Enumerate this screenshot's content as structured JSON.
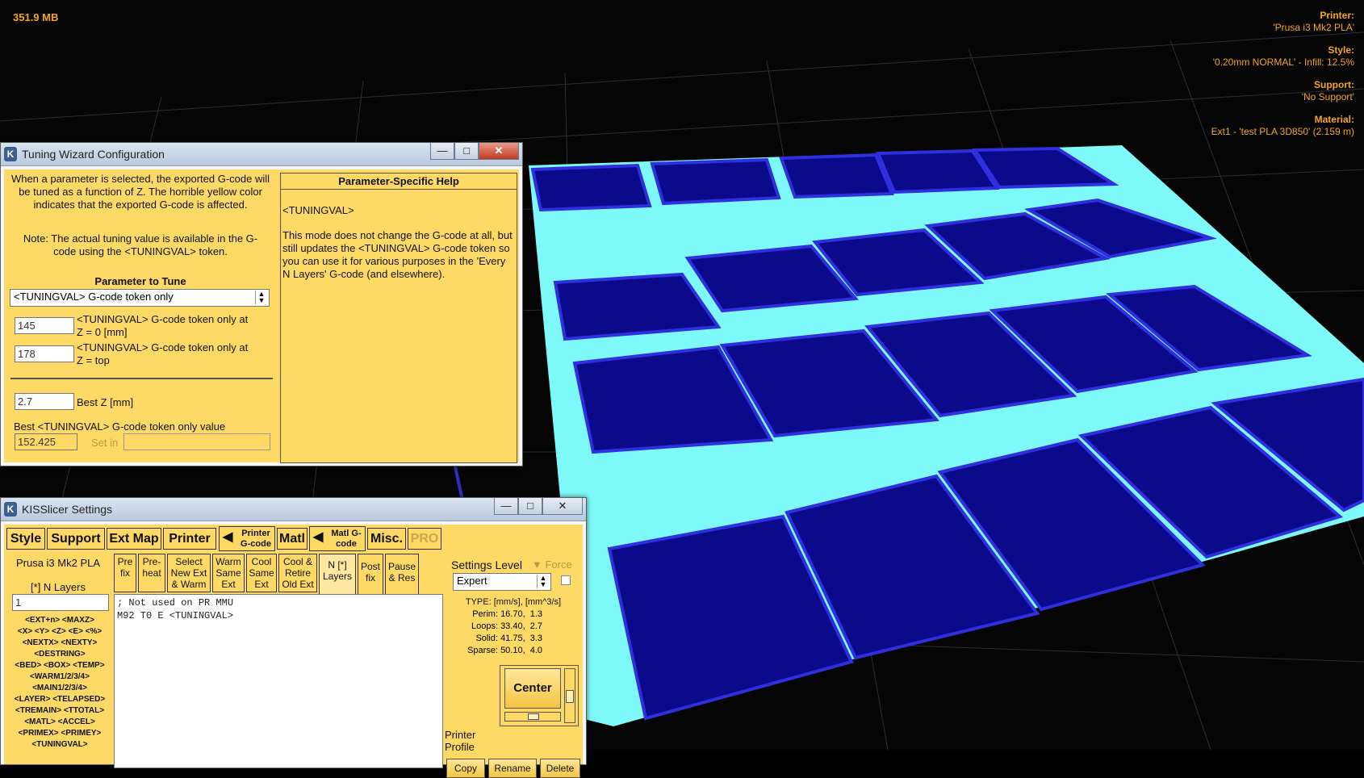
{
  "memory": "351.9 MB",
  "info": [
    {
      "label": "Printer:",
      "value": "'Prusa i3 Mk2 PLA'"
    },
    {
      "label": "Style:",
      "value": "'0.20mm NORMAL' - Infill: 12.5%"
    },
    {
      "label": "Support:",
      "value": "'No Support'"
    },
    {
      "label": "Material:",
      "value": "Ext1 - 'test PLA 3D850' (2.159 m)"
    }
  ],
  "tuning": {
    "title": "Tuning Wizard Configuration",
    "min_icon": "minimize-icon",
    "desc1": "When a parameter is selected, the exported G-code will be tuned as a function of Z.  The horrible yellow color indicates that the exported G-code is affected.",
    "desc2": "Note: The actual tuning value is available in the G-code using the <TUNINGVAL> token.",
    "param_heading": "Parameter to Tune",
    "param_selected": "<TUNINGVAL> G-code token only",
    "z0_value": "145",
    "z0_label": "<TUNINGVAL> G-code token only at Z = 0 [mm]",
    "ztop_value": "178",
    "ztop_label": "<TUNINGVAL> G-code token only at Z = top",
    "bestz_value": "2.7",
    "bestz_label": "Best Z [mm]",
    "best_value_label": "Best <TUNINGVAL> G-code token only value",
    "best_value": "152.425",
    "set_in_label": "Set in",
    "help_heading": "Parameter-Specific Help",
    "help_token": "<TUNINGVAL>",
    "help_text": "This mode does not change the G-code at all, but still updates the <TUNINGVAL> G-code token so you can use it for various purposes in the 'Every N Layers' G-code (and elsewhere)."
  },
  "settings": {
    "title": "KISSlicer Settings",
    "tabs": [
      "Style",
      "Support",
      "Ext Map",
      "Printer",
      "Printer G-code",
      "Matl",
      "Matl G-code",
      "Misc.",
      "PRO"
    ],
    "printer_name": "Prusa i3 Mk2 PLA",
    "n_layers_label": "[*] N Layers",
    "n_layers_value": "1",
    "tokens": [
      "<EXT+n> <MAXZ>",
      "<X> <Y> <Z> <E> <%>",
      "<NEXTX> <NEXTY>",
      "<DESTRING>",
      "<BED> <BOX> <TEMP>",
      "<WARM1/2/3/4>",
      "<MAIN1/2/3/4>",
      "<LAYER> <TELAPSED>",
      "<TREMAIN> <TTOTAL>",
      "<MATL> <ACCEL>",
      "<PRIMEX> <PRIMEY>",
      "<TUNINGVAL>"
    ],
    "subtabs": [
      "Pre fix",
      "Pre- heat",
      "Select New Ext & Warm",
      "Warm Same Ext",
      "Cool Same Ext",
      "Cool & Retire Old Ext",
      "N [*] Layers",
      "Post fix",
      "Pause & Res"
    ],
    "gcode_lines": [
      "; Not used on PR MMU",
      "M92 T0 E <TUNINGVAL>"
    ],
    "settings_level_label": "Settings Level",
    "force_label": "Force",
    "level_value": "Expert",
    "type_header": "TYPE: [mm/s], [mm^3/s]",
    "speeds": [
      {
        "name": "Perim:",
        "val": "16.70,  1.3"
      },
      {
        "name": "Loops:",
        "val": "33.40,  2.7"
      },
      {
        "name": "Solid:",
        "val": "41.75,  3.3"
      },
      {
        "name": "Sparse:",
        "val": "50.10,  4.0"
      }
    ],
    "center_label": "Center",
    "printer_profile_label": "Printer Profile",
    "bottom_buttons": [
      "Copy",
      "Rename",
      "Delete"
    ]
  }
}
